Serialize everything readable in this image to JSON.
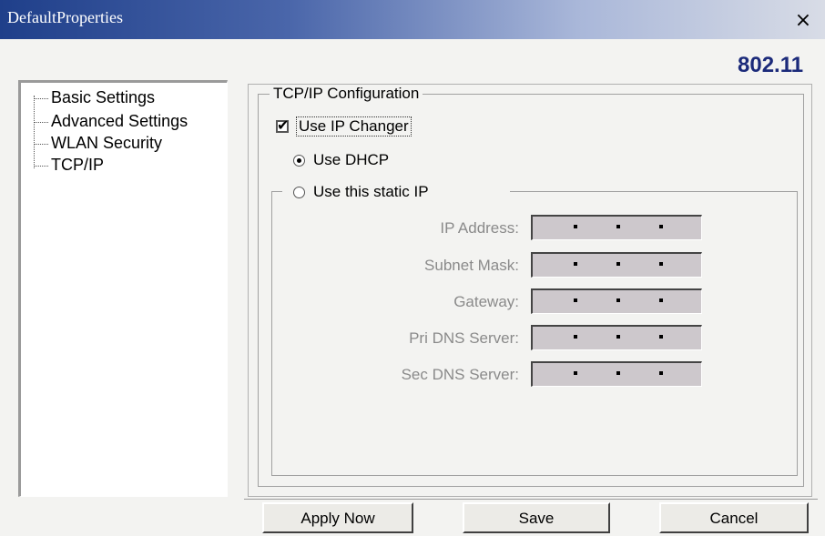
{
  "window": {
    "title": "DefaultProperties",
    "close_label": "×",
    "version": "802.11"
  },
  "sidebar": {
    "items": [
      {
        "label": "Basic Settings"
      },
      {
        "label": "Advanced Settings"
      },
      {
        "label": "WLAN Security"
      },
      {
        "label": "TCP/IP"
      }
    ]
  },
  "tcpip": {
    "group_title": "TCP/IP Configuration",
    "use_ip_changer": {
      "label": "Use IP Changer",
      "checked": true
    },
    "use_dhcp": {
      "label": "Use DHCP",
      "selected": true
    },
    "use_static": {
      "label": "Use this static IP",
      "selected": false
    },
    "fields": [
      {
        "label": "IP Address:",
        "value": ""
      },
      {
        "label": "Subnet Mask:",
        "value": ""
      },
      {
        "label": "Gateway:",
        "value": ""
      },
      {
        "label": "Pri DNS Server:",
        "value": ""
      },
      {
        "label": "Sec DNS Server:",
        "value": ""
      }
    ]
  },
  "buttons": {
    "apply": "Apply Now",
    "save": "Save",
    "cancel": "Cancel"
  }
}
